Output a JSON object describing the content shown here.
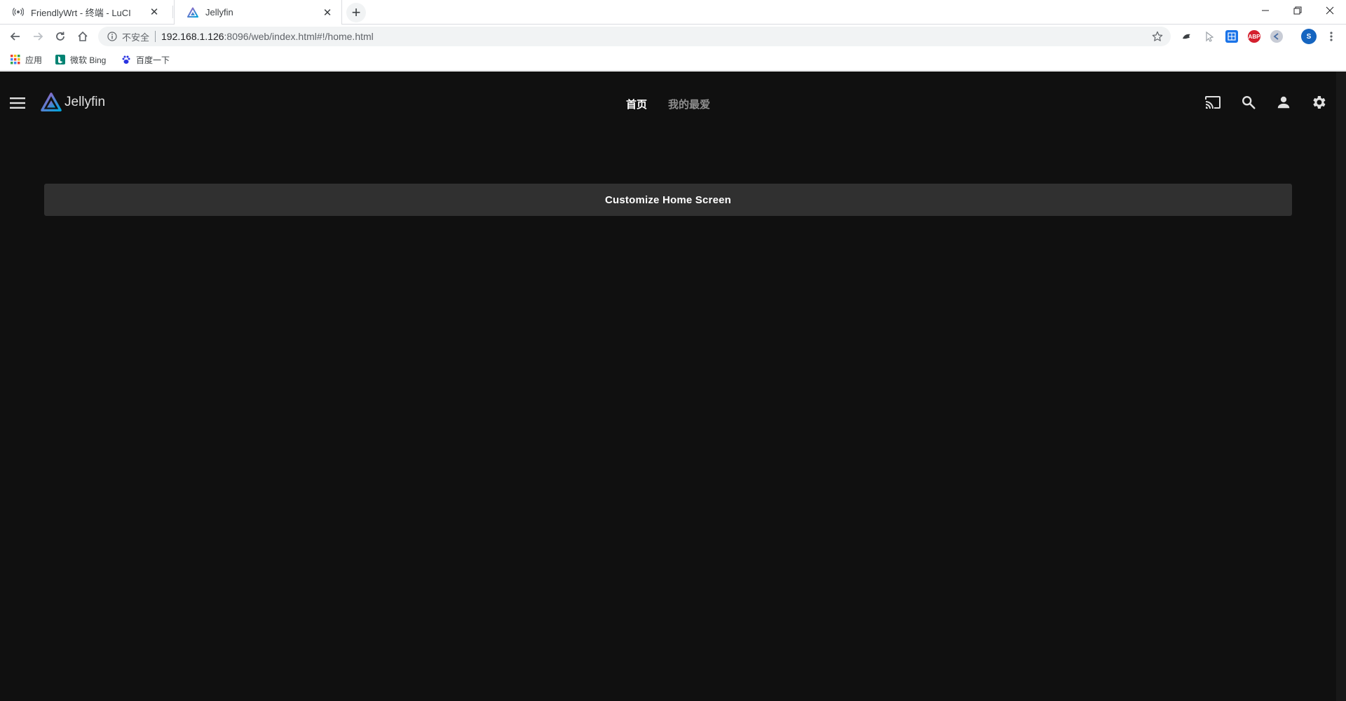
{
  "browser": {
    "tabs": [
      {
        "title": "FriendlyWrt - 终端 - LuCI",
        "active": false
      },
      {
        "title": "Jellyfin",
        "active": true
      }
    ],
    "address": {
      "security_label": "不安全",
      "url_host": "192.168.1.126",
      "url_path": ":8096/web/index.html#!/home.html"
    },
    "profile_initial": "S",
    "extensions": [
      {
        "name": "adblock-icon",
        "label": "ABP",
        "color": "#d4202e"
      }
    ],
    "bookmarks": [
      {
        "label": "应用"
      },
      {
        "label": "微软 Bing"
      },
      {
        "label": "百度一下"
      }
    ]
  },
  "app": {
    "brand_name": "Jellyfin",
    "nav_tabs": [
      {
        "label": "首页",
        "active": true
      },
      {
        "label": "我的最爱",
        "active": false
      }
    ],
    "customize_label": "Customize Home Screen",
    "colors": {
      "background": "#101010",
      "button_bg": "#303030",
      "accent_purple": "#aa5cc3",
      "accent_blue": "#00a4dc"
    }
  }
}
